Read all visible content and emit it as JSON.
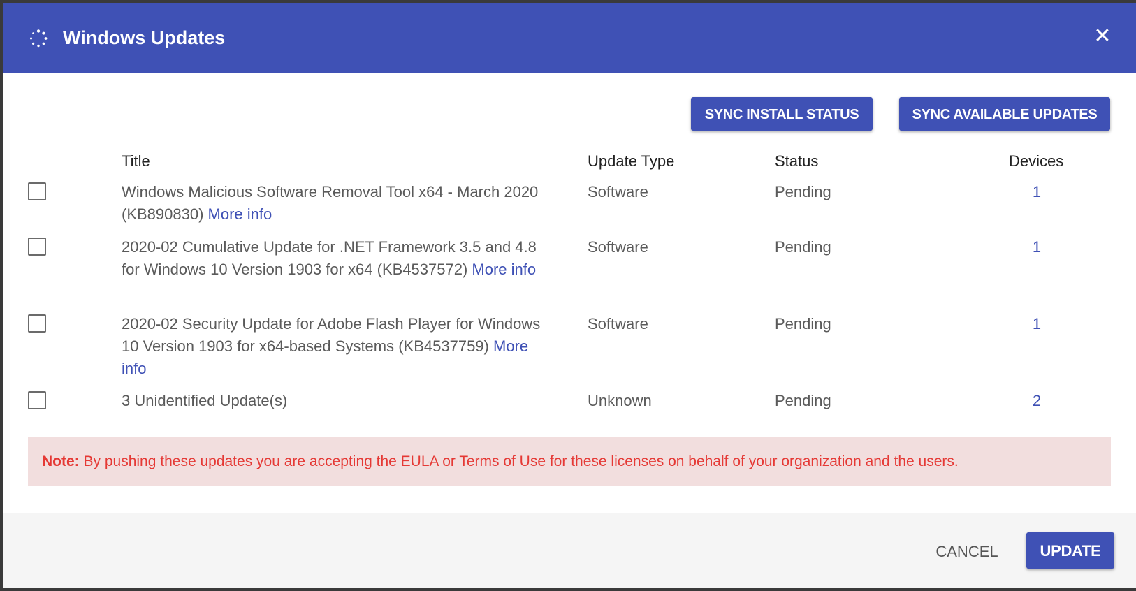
{
  "dialog": {
    "title": "Windows Updates",
    "close_icon": "close-icon",
    "header_icon": "spinner-icon",
    "accent_color": "#3f51b5"
  },
  "toolbar": {
    "sync_install_label": "SYNC INSTALL STATUS",
    "sync_available_label": "SYNC AVAILABLE UPDATES"
  },
  "table": {
    "headers": {
      "title": "Title",
      "update_type": "Update Type",
      "status": "Status",
      "devices": "Devices"
    },
    "rows": [
      {
        "title": "Windows Malicious Software Removal Tool x64 - March 2020 (KB890830)",
        "more_info": "More info",
        "update_type": "Software",
        "status": "Pending",
        "devices": "1",
        "checked": false
      },
      {
        "title": "2020-02 Cumulative Update for .NET Framework 3.5 and 4.8 for Windows 10 Version 1903 for x64 (KB4537572)",
        "more_info": "More info",
        "update_type": "Software",
        "status": "Pending",
        "devices": "1",
        "checked": false
      },
      {
        "title": "2020-02 Security Update for Adobe Flash Player for Windows 10 Version 1903 for x64-based Systems (KB4537759)",
        "more_info": "More info",
        "update_type": "Software",
        "status": "Pending",
        "devices": "1",
        "checked": false
      },
      {
        "title": "3 Unidentified Update(s)",
        "more_info": "",
        "update_type": "Unknown",
        "status": "Pending",
        "devices": "2",
        "checked": false
      }
    ]
  },
  "note": {
    "label": "Note:",
    "text": "By pushing these updates you are accepting the EULA or Terms of Use for these licenses on behalf of your organization and the users.",
    "color": "#e53935",
    "background": "#f2dede"
  },
  "footer": {
    "cancel_label": "CANCEL",
    "update_label": "UPDATE"
  }
}
